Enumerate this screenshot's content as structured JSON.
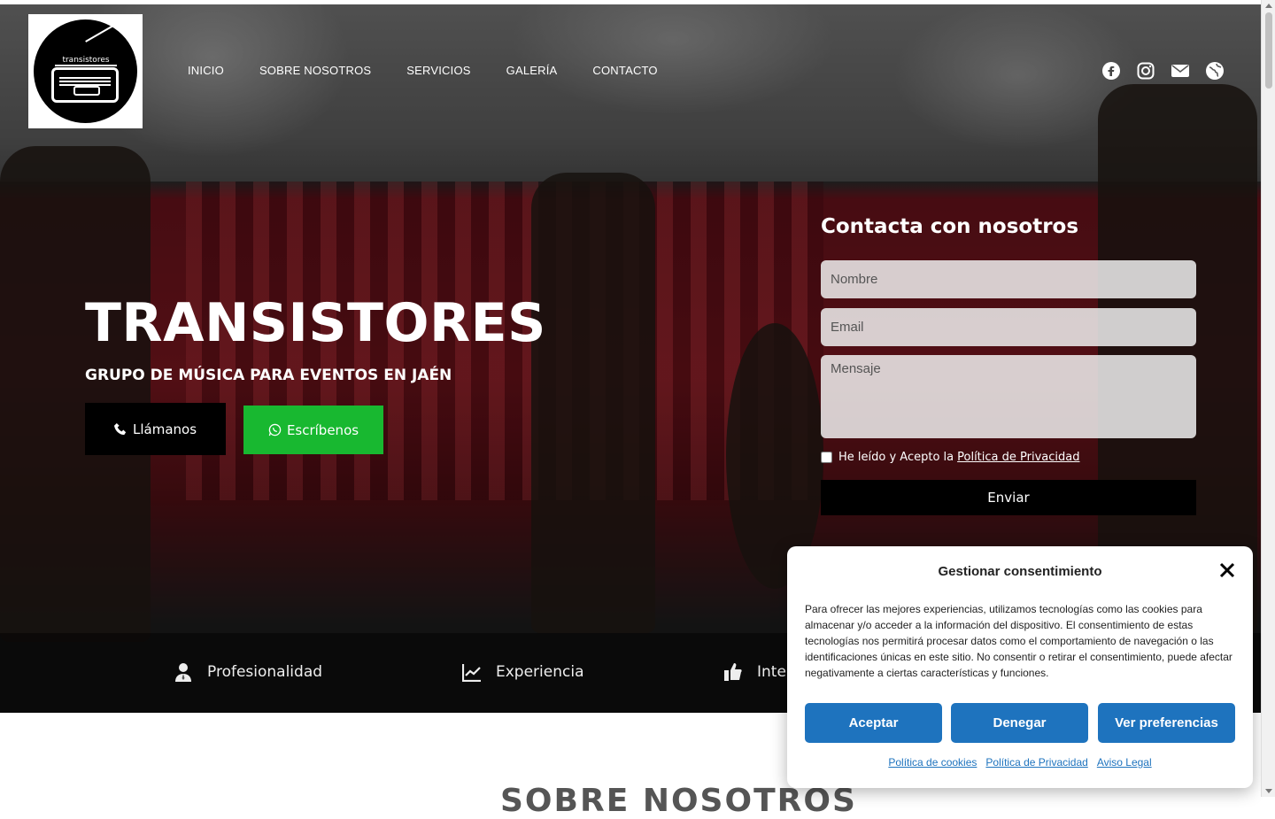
{
  "brand": {
    "logo_text": "transistores"
  },
  "nav": {
    "items": [
      "INICIO",
      "SOBRE NOSOTROS",
      "SERVICIOS",
      "GALERÍA",
      "CONTACTO"
    ]
  },
  "social": {
    "icons": [
      "facebook-icon",
      "instagram-icon",
      "envelope-icon",
      "globe-icon"
    ]
  },
  "hero": {
    "title": "TRANSISTORES",
    "subtitle": "GRUPO DE MÚSICA PARA EVENTOS EN JAÉN",
    "call_label": "Llámanos",
    "whatsapp_label": "Escríbenos"
  },
  "form": {
    "title": "Contacta con nosotros",
    "name_placeholder": "Nombre",
    "email_placeholder": "Email",
    "message_placeholder": "Mensaje",
    "consent_text": "He leído y Acepto la",
    "consent_link": "Política de Privacidad",
    "send_label": "Enviar"
  },
  "features": [
    "Profesionalidad",
    "Experiencia",
    "Inte"
  ],
  "about": {
    "title": "SOBRE NOSOTROS"
  },
  "cookie": {
    "title": "Gestionar consentimiento",
    "body": "Para ofrecer las mejores experiencias, utilizamos tecnologías como las cookies para almacenar y/o acceder a la información del dispositivo. El consentimiento de estas tecnologías nos permitirá procesar datos como el comportamiento de navegación o las identificaciones únicas en este sitio. No consentir o retirar el consentimiento, puede afectar negativamente a ciertas características y funciones.",
    "accept_label": "Aceptar",
    "deny_label": "Denegar",
    "prefs_label": "Ver preferencias",
    "links": [
      "Política de cookies",
      "Política de Privacidad",
      "Aviso Legal"
    ]
  },
  "colors": {
    "whatsapp_green": "#18b830",
    "cookie_blue": "#1e73be"
  }
}
